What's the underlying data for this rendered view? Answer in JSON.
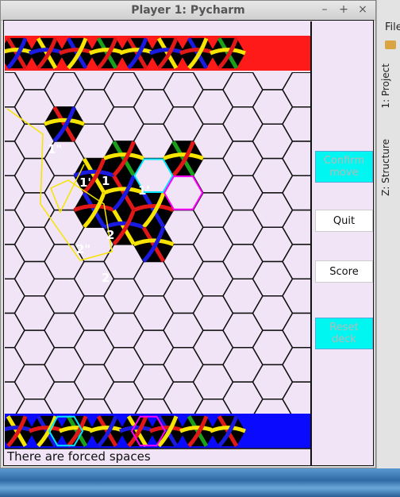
{
  "window": {
    "title": "Player 1: Pycharm",
    "controls": [
      "–",
      "+",
      "×"
    ]
  },
  "board": {
    "background_color": "#f0e4f6",
    "hex_stroke": "#111111",
    "highlight_cyan": "#00e6ff",
    "highlight_magenta": "#ff00ff",
    "tile_colors": {
      "red": "#e01818",
      "blue": "#1a1ae0",
      "yellow": "#f7e400",
      "green": "#1aa01a",
      "black": "#000000"
    },
    "labels": [
      "1\"",
      "1'",
      "1",
      "1'",
      "2",
      "2\"",
      "2"
    ],
    "top_tray_color": "#ff1a1a",
    "bottom_tray_color": "#0a0aff"
  },
  "status": {
    "text": "There are forced spaces"
  },
  "sidebar": {
    "confirm_label": "Confirm move",
    "quit_label": "Quit",
    "score_label": "Score",
    "reset_label": "Reset deck"
  },
  "ide": {
    "menu_label": "File",
    "tab_project": "1: Project",
    "tab_structure": "Z: Structure"
  }
}
